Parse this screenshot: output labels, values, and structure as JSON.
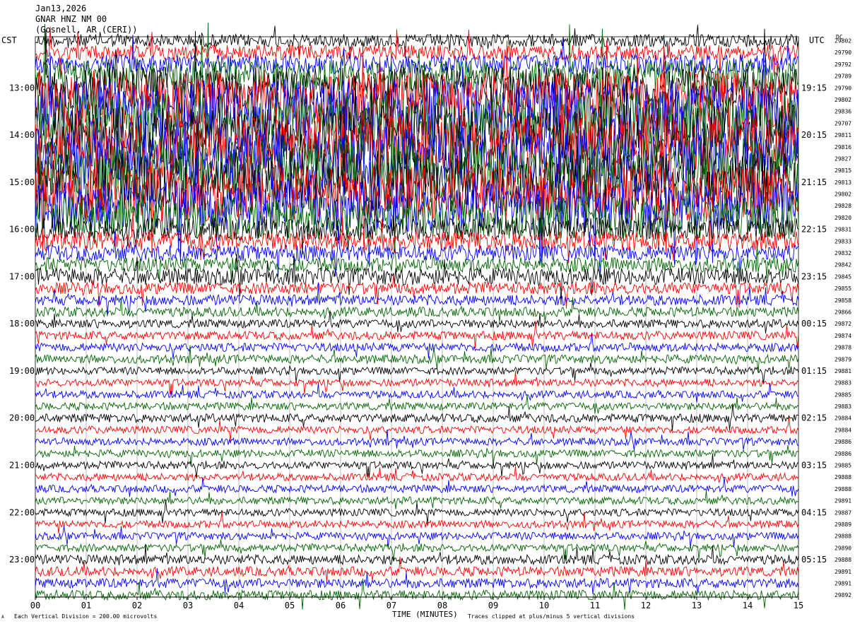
{
  "header": {
    "date": "Jan13,2026",
    "station": "GNAR HNZ NM 00",
    "location": "(Gosnell, AR (CERI))",
    "left_zone": "CST",
    "right_zone": "UTC",
    "dc_label": "DC"
  },
  "footer": {
    "scale_note": "Each Vertical Division =  200.00 microvolts",
    "clip_note": "Traces clipped at plus/minus 5 vertical divisions",
    "corner_mark": "A"
  },
  "colors": {
    "trace_cycle": [
      "#000000",
      "#ff0000",
      "#0000ff",
      "#006400"
    ],
    "gridline": "#9a9a9a",
    "background": "#ffffff"
  },
  "chart_data": {
    "type": "line",
    "title": "",
    "xlabel": "TIME (MINUTES)",
    "ylabel": "",
    "xlim": [
      0,
      15
    ],
    "x_ticks": [
      "00",
      "01",
      "02",
      "03",
      "04",
      "05",
      "06",
      "07",
      "08",
      "09",
      "10",
      "11",
      "12",
      "13",
      "14",
      "15"
    ],
    "left_hour_labels": [
      "13:00",
      "14:00",
      "15:00",
      "16:00",
      "17:00",
      "18:00",
      "19:00",
      "20:00",
      "21:00",
      "22:00",
      "23:00"
    ],
    "right_hour_labels": [
      "19:15",
      "20:15",
      "21:15",
      "22:15",
      "23:15",
      "00:15",
      "01:15",
      "02:15",
      "03:15",
      "04:15",
      "05:15"
    ],
    "trace_count": 48,
    "traces_per_hour": 4,
    "dc_offsets": [
      29802,
      29790,
      29792,
      29789,
      29790,
      29802,
      29836,
      29707,
      29811,
      29816,
      29827,
      29815,
      29813,
      29802,
      29828,
      29820,
      29831,
      29833,
      29832,
      29842,
      29845,
      29855,
      29858,
      29866,
      29872,
      29874,
      29878,
      29879,
      29881,
      29883,
      29885,
      29883,
      29884,
      29884,
      29886,
      29886,
      29885,
      29888,
      29888,
      29891,
      29887,
      29889,
      29888,
      29890,
      29888,
      29891,
      29891,
      29892
    ],
    "relative_amplitude": [
      0.6,
      0.7,
      0.9,
      1.5,
      2.0,
      2.6,
      3.0,
      3.0,
      2.8,
      3.0,
      3.0,
      3.0,
      2.8,
      2.6,
      2.4,
      2.0,
      1.1,
      0.9,
      0.75,
      0.7,
      0.8,
      0.55,
      0.5,
      0.45,
      0.4,
      0.4,
      0.4,
      0.4,
      0.35,
      0.35,
      0.35,
      0.35,
      0.4,
      0.35,
      0.35,
      0.35,
      0.35,
      0.35,
      0.35,
      0.35,
      0.35,
      0.35,
      0.35,
      0.35,
      0.45,
      0.45,
      0.45,
      0.45
    ],
    "grid": true,
    "legend": "none"
  }
}
